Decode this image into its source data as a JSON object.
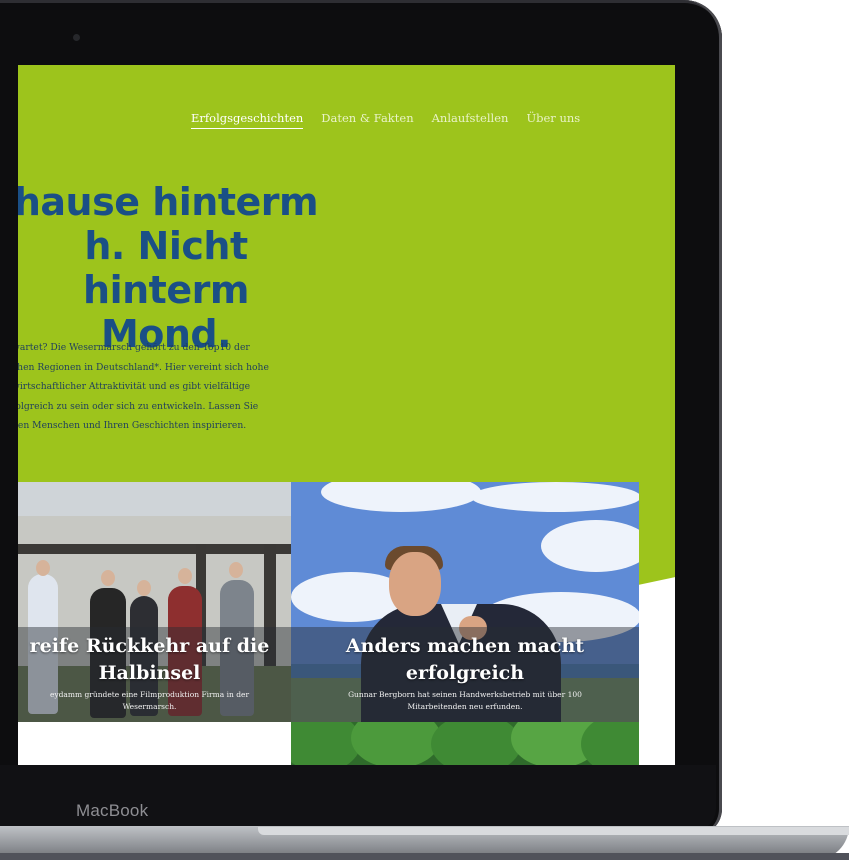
{
  "device": {
    "brand_label": "MacBook"
  },
  "nav": {
    "items": [
      {
        "label": "Erfolgsgeschichten",
        "active": true
      },
      {
        "label": "Daten & Fakten",
        "active": false
      },
      {
        "label": "Anlaufstellen",
        "active": false
      },
      {
        "label": "Über uns",
        "active": false
      }
    ]
  },
  "hero": {
    "title_line1": "hause hinterm",
    "title_line2": "h. Nicht hinterm",
    "title_line3": "Mond.",
    "text_line1": "wartet? Die Wesermarsch gehört zu den Top10 der",
    "text_line2": "chen Regionen in Deutschland*. Hier vereint sich hohe",
    "text_line3": "wirtschaftlicher Attraktivität und es gibt vielfältige",
    "text_line4": "folgreich zu sein oder sich zu entwickeln. Lassen Sie",
    "text_line5": "den Menschen und Ihren Geschichten inspirieren."
  },
  "cards": [
    {
      "title_line1": "reife Rückkehr auf die",
      "title_line2": "Halbinsel",
      "subtitle_line1": "eydamm gründete eine Filmproduktion Firma in der",
      "subtitle_line2": "Wesermarsch."
    },
    {
      "title_line1": "Anders machen macht",
      "title_line2": "erfolgreich",
      "subtitle_line1": "Gunnar Bergborn hat seinen Handwerksbetrieb mit über 100",
      "subtitle_line2": "Mitarbeitenden neu erfunden."
    }
  ],
  "colors": {
    "hero_background": "#9dc41c",
    "title_blue": "#1a4f86",
    "side_strip": "#0b4f93"
  }
}
